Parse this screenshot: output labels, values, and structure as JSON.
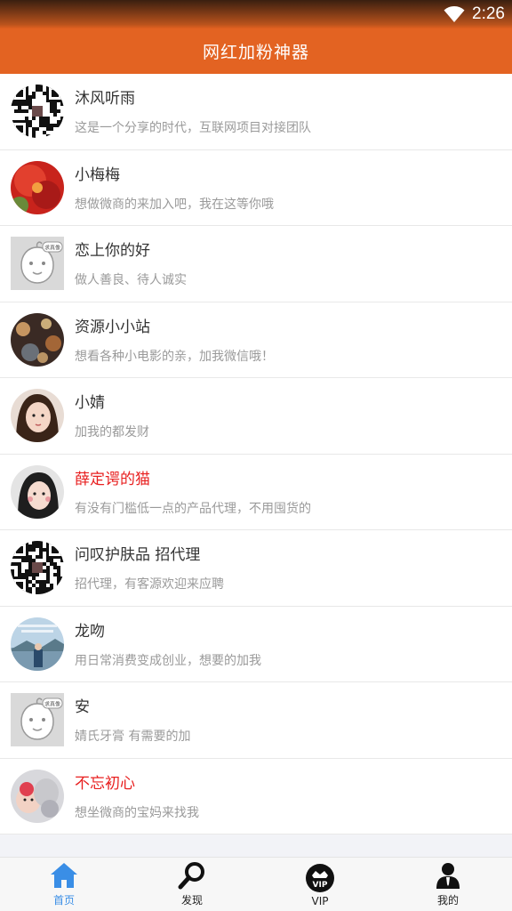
{
  "status": {
    "time": "2:26",
    "wifi_icon": "wifi-icon"
  },
  "header": {
    "title": "网红加粉神器",
    "background": "#e36322"
  },
  "contacts": [
    {
      "name": "沐风听雨",
      "desc": "这是一个分享的时代，互联网项目对接团队",
      "highlight": false,
      "avatar": "qr-code-avatar"
    },
    {
      "name": "小梅梅",
      "desc": "想做微商的来加入吧，我在这等你哦",
      "highlight": false,
      "avatar": "flower-photo-avatar"
    },
    {
      "name": "恋上你的好",
      "desc": "做人善良、待人诚实",
      "highlight": false,
      "avatar": "default-cartoon-avatar",
      "avatar_badge": "求真像"
    },
    {
      "name": "资源小小站",
      "desc": "想看各种小电影的亲，加我微信哦！",
      "highlight": false,
      "avatar": "bokeh-lights-avatar"
    },
    {
      "name": "小婧",
      "desc": "加我的都发财",
      "highlight": false,
      "avatar": "girl-photo-avatar"
    },
    {
      "name": "薛定谔的猫",
      "desc": "有没有门槛低一点的产品代理，不用囤货的",
      "highlight": true,
      "avatar": "girl-selfie-avatar"
    },
    {
      "name": "问叹护肤品  招代理",
      "desc": "招代理，有客源欢迎来应聘",
      "highlight": false,
      "avatar": "qr-code-avatar"
    },
    {
      "name": "龙吻",
      "desc": "用日常消费变成创业，想要的加我",
      "highlight": false,
      "avatar": "landscape-avatar"
    },
    {
      "name": "安",
      "desc": "婧氏牙膏  有需要的加",
      "highlight": false,
      "avatar": "default-cartoon-avatar",
      "avatar_badge": "求真像"
    },
    {
      "name": "不忘初心",
      "desc": "想坐微商的宝妈来找我",
      "highlight": true,
      "avatar": "baby-photo-avatar"
    }
  ],
  "bottom_nav": [
    {
      "label": "首页",
      "icon": "home-icon",
      "active": true
    },
    {
      "label": "发现",
      "icon": "search-icon",
      "active": false
    },
    {
      "label": "VIP",
      "icon": "vip-crown-icon",
      "active": false
    },
    {
      "label": "我的",
      "icon": "user-icon",
      "active": false
    }
  ],
  "colors": {
    "accent": "#e36322",
    "highlight_name": "#e82020",
    "nav_active": "#3a8ee6"
  }
}
